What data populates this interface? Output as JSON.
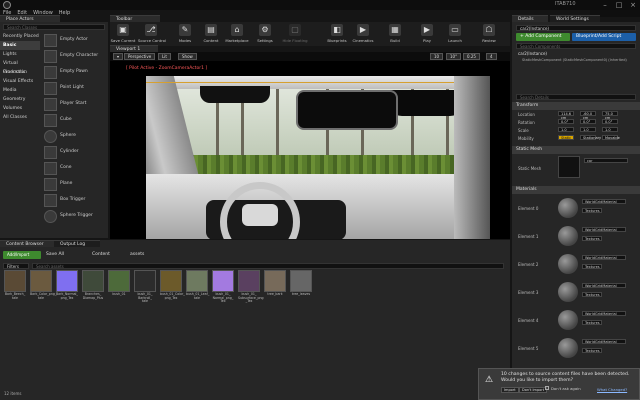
{
  "title_bar": {
    "document": "ITAB710"
  },
  "menu": [
    "File",
    "Edit",
    "Window",
    "Help"
  ],
  "tabs": {
    "place_actors": "Place Actors",
    "toolbar": "Toolbar",
    "viewport": "Viewport 1",
    "details": "Details",
    "world_settings": "World Settings",
    "content_browser": "Content Browser",
    "output_log": "Output Log"
  },
  "place_panel": {
    "search_placeholder": "Search Classes",
    "categories": [
      "Recently Placed",
      "Basic",
      "Lights",
      "Virtual Production",
      "Cinematic",
      "Visual Effects",
      "Media",
      "Geometry",
      "Volumes",
      "All Classes"
    ],
    "active_category": "Basic",
    "items": [
      "Empty Actor",
      "Empty Character",
      "Empty Pawn",
      "Point Light",
      "Player Start",
      "Cube",
      "Sphere",
      "Cylinder",
      "Cone",
      "Plane",
      "Box Trigger",
      "Sphere Trigger"
    ]
  },
  "toolbar": {
    "buttons": [
      "Save Current",
      "Source Control",
      "Modes",
      "Content",
      "Marketplace",
      "Settings",
      "Blueprints",
      "Cinematics",
      "Build",
      "Play",
      "Launch",
      "Review"
    ],
    "hidden_label": "Hide Floating"
  },
  "viewport": {
    "perspective": "Perspective",
    "lit": "Lit",
    "show": "Show",
    "pilot_label": "[ Pilot Active - ZoomCameraActor1 ]",
    "snap_values": [
      "10",
      "10°",
      "0.25",
      "4"
    ]
  },
  "details": {
    "actor_name": "car2(Instance)",
    "add_component": "+ Add Component",
    "blueprint_script": "Blueprint/Add Script",
    "search_components": "Search Components",
    "component_root": "car2(Instance)",
    "component_child": "StaticMeshComponent (StaticMeshComponent0) (Inherited)",
    "search_details": "Search Details",
    "transform_section": "Transform",
    "location_label": "Location",
    "rotation_label": "Rotation",
    "scale_label": "Scale",
    "mobility_label": "Mobility",
    "location": [
      "114.6 cm",
      "-60.0 cm",
      "75.0 cm"
    ],
    "rotation": [
      "0.0°",
      "0.0°",
      "0.0°"
    ],
    "scale": [
      "1.0",
      "1.0",
      "1.0"
    ],
    "mobility": [
      "Static",
      "Stationary",
      "Movable"
    ],
    "static_mesh_section": "Static Mesh",
    "static_mesh_label": "Static Mesh",
    "static_mesh_value": "car",
    "materials_section": "Materials",
    "elements": [
      {
        "label": "Element 0",
        "material": "WorldGridMaterial",
        "tag": "Textures"
      },
      {
        "label": "Element 1",
        "material": "WorldGridMaterial",
        "tag": "Textures"
      },
      {
        "label": "Element 2",
        "material": "WorldGridMaterial",
        "tag": "Textures"
      },
      {
        "label": "Element 3",
        "material": "WorldGridMaterial",
        "tag": "Textures"
      },
      {
        "label": "Element 4",
        "material": "WorldGridMaterial",
        "tag": "Textures"
      },
      {
        "label": "Element 5",
        "material": "WorldGridMaterial",
        "tag": "Textures"
      }
    ]
  },
  "content_browser": {
    "add_import": "Add/Import",
    "save_all": "Save All",
    "path_content": "Content",
    "path_assets": "assets",
    "filters": "Filters",
    "search_placeholder": "Search assets",
    "item_count": "12 items",
    "view_options": "View Options",
    "assets": [
      {
        "name": "Bark_Beech_\ntale",
        "color": "#5a4a35"
      },
      {
        "name": "Bark_Color_png_\ntale",
        "color": "#6b5a3f"
      },
      {
        "name": "Bark_Normal_\npng_Tex",
        "color": "#7f6ff0"
      },
      {
        "name": "Branches_\nDiamap_Plus",
        "color": "#3f4a3a"
      },
      {
        "name": "bush_01",
        "color": "#4d6a3a"
      },
      {
        "name": "bush_01_\nBarkroll_\ntale",
        "color": "#2c2c2c"
      },
      {
        "name": "bush_01_Color_\npng_Tex",
        "color": "#6c5a2a"
      },
      {
        "name": "bush_01_Leaf_\ntale",
        "color": "#6e7a60"
      },
      {
        "name": "bush_01_\nNormal_png_\nTex",
        "color": "#a37ae0"
      },
      {
        "name": "bush_01_\nSubsurface_png\n_Tex",
        "color": "#5a4060"
      },
      {
        "name": "tree_bark",
        "color": "#776a5a"
      },
      {
        "name": "tree_leaves",
        "color": "#666666"
      }
    ]
  },
  "notification": {
    "line1": "10 changes to source content files have been detected.",
    "line2": "Would you like to import them?",
    "import": "Import",
    "dont_import": "Don't Import",
    "dont_ask": "Don't ask again",
    "what_changed": "What Changed?"
  }
}
